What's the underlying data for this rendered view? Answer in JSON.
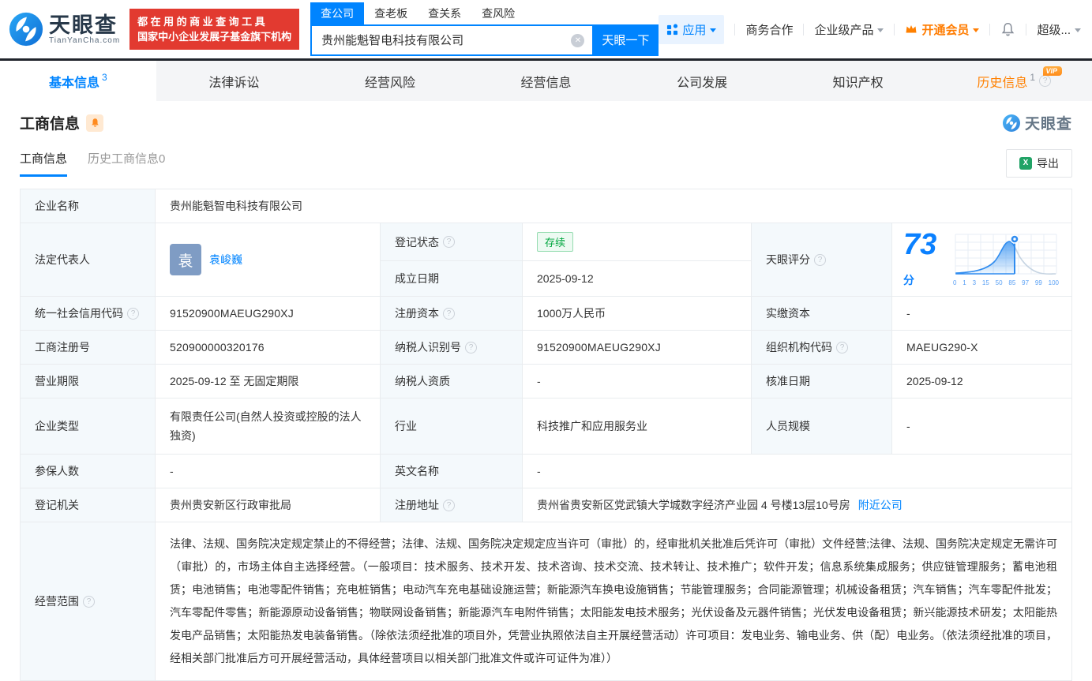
{
  "header": {
    "logo": {
      "title": "天眼查",
      "domain": "TianYanCha.com"
    },
    "promo": {
      "line1": "都在用的商业查询工具",
      "line2": "国家中小企业发展子基金旗下机构"
    },
    "search": {
      "tabs": [
        {
          "label": "查公司"
        },
        {
          "label": "查老板"
        },
        {
          "label": "查关系"
        },
        {
          "label": "查风险"
        }
      ],
      "value": "贵州能魁智电科技有限公司",
      "button": "天眼一下"
    },
    "nav": {
      "apps": "应用",
      "cooperation": "商务合作",
      "enterprise": "企业级产品",
      "vip": "开通会员",
      "more": "超级..."
    }
  },
  "tabs": [
    {
      "label": "基本信息",
      "count": "3"
    },
    {
      "label": "法律诉讼",
      "count": ""
    },
    {
      "label": "经营风险",
      "count": ""
    },
    {
      "label": "经营信息",
      "count": ""
    },
    {
      "label": "公司发展",
      "count": ""
    },
    {
      "label": "知识产权",
      "count": ""
    },
    {
      "label": "历史信息",
      "count": "1",
      "badge": "VIP"
    }
  ],
  "section": {
    "title": "工商信息",
    "watermark": "天眼查",
    "subtabs": [
      {
        "label": "工商信息"
      },
      {
        "label": "历史工商信息0"
      }
    ],
    "export_label": "导出"
  },
  "table": {
    "company_name": {
      "label": "企业名称",
      "value": "贵州能魁智电科技有限公司"
    },
    "legal_rep": {
      "label": "法定代表人",
      "avatar": "袁",
      "name": "袁峻巍"
    },
    "reg_status": {
      "label": "登记状态",
      "value": "存续"
    },
    "establish_date": {
      "label": "成立日期",
      "value": "2025-09-12"
    },
    "score": {
      "label": "天眼评分",
      "value": "73",
      "unit": "分",
      "axis": [
        "0",
        "1",
        "3",
        "15",
        "50",
        "85",
        "97",
        "99",
        "100"
      ]
    },
    "uscc": {
      "label": "统一社会信用代码",
      "value": "91520900MAEUG290XJ"
    },
    "reg_capital": {
      "label": "注册资本",
      "value": "1000万人民币"
    },
    "paid_capital": {
      "label": "实缴资本",
      "value": "-"
    },
    "reg_number": {
      "label": "工商注册号",
      "value": "520900000320176"
    },
    "taxpayer_id": {
      "label": "纳税人识别号",
      "value": "91520900MAEUG290XJ"
    },
    "org_code": {
      "label": "组织机构代码",
      "value": "MAEUG290-X"
    },
    "business_term": {
      "label": "营业期限",
      "value": "2025-09-12 至 无固定期限"
    },
    "taxpayer_quality": {
      "label": "纳税人资质",
      "value": "-"
    },
    "approval_date": {
      "label": "核准日期",
      "value": "2025-09-12"
    },
    "company_type": {
      "label": "企业类型",
      "value": "有限责任公司(自然人投资或控股的法人独资)"
    },
    "industry": {
      "label": "行业",
      "value": "科技推广和应用服务业"
    },
    "staff_size": {
      "label": "人员规模",
      "value": "-"
    },
    "insured_count": {
      "label": "参保人数",
      "value": "-"
    },
    "english_name": {
      "label": "英文名称",
      "value": "-"
    },
    "reg_authority": {
      "label": "登记机关",
      "value": "贵州贵安新区行政审批局"
    },
    "reg_address": {
      "label": "注册地址",
      "value": "贵州省贵安新区党武镇大学城数字经济产业园 4 号楼13层10号房",
      "link": "附近公司"
    },
    "business_scope": {
      "label": "经营范围",
      "value": "法律、法规、国务院决定规定禁止的不得经营；法律、法规、国务院决定规定应当许可（审批）的，经审批机关批准后凭许可（审批）文件经营;法律、法规、国务院决定规定无需许可（审批）的，市场主体自主选择经营。（一般项目：技术服务、技术开发、技术咨询、技术交流、技术转让、技术推广；软件开发；信息系统集成服务；供应链管理服务；蓄电池租赁；电池销售；电池零配件销售；充电桩销售；电动汽车充电基础设施运营；新能源汽车换电设施销售；节能管理服务；合同能源管理；机械设备租赁；汽车销售；汽车零配件批发；汽车零配件零售；新能源原动设备销售；物联网设备销售；新能源汽车电附件销售；太阳能发电技术服务；光伏设备及元器件销售；光伏发电设备租赁；新兴能源技术研发；太阳能热发电产品销售；太阳能热发电装备销售。（除依法须经批准的项目外，凭营业执照依法自主开展经营活动）许可项目：发电业务、输电业务、供（配）电业务。（依法须经批准的项目，经相关部门批准后方可开展经营活动，具体经营项目以相关部门批准文件或许可证件为准））"
    }
  },
  "colors": {
    "accent": "#0084ff",
    "orange": "#ff8000",
    "green": "#00a63f",
    "red": "#e23a30",
    "score_blue": "#0a80ff"
  }
}
